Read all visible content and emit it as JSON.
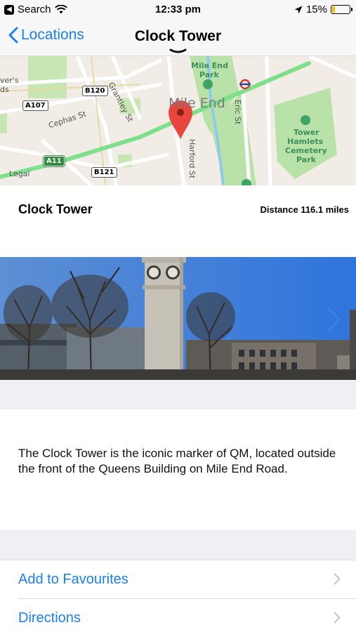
{
  "status_bar": {
    "back_app": "Search",
    "time": "12:33 pm",
    "battery": "15%",
    "battery_level": 0.15,
    "icons": [
      "wifi-icon",
      "location-arrow-icon",
      "battery-icon"
    ]
  },
  "nav": {
    "back_label": "Locations",
    "title": "Clock Tower"
  },
  "map": {
    "labels": {
      "mile_end_park": "Mile End Park",
      "mile_end_park_line1": "Mile End",
      "mile_end_park_line2": "Park",
      "area": "Mile End",
      "tower_hamlets_line1": "Tower",
      "tower_hamlets_line2": "Hamlets",
      "tower_hamlets_line3": "Cemetery",
      "tower_hamlets_line4": "Park",
      "grantley": "Grantley St",
      "cephas": "Cephas St",
      "eric": "Eric St",
      "harford": "Harford St",
      "partial_left_1": "ver's",
      "partial_left_2": "ds",
      "legal": "Legal"
    },
    "roads": {
      "b120": "B120",
      "a107": "A107",
      "a11": "A11",
      "b121": "B121"
    },
    "colors": {
      "pin": "#e8453c",
      "road_green": "#7ee08b",
      "park": "#b9e2a8"
    }
  },
  "place": {
    "name": "Clock Tower",
    "distance": "Distance 116.1 miles"
  },
  "description": "The Clock Tower is the iconic marker of QM, located outside the front of the Queens Building on Mile End Road.",
  "actions": {
    "favourites": "Add to Favourites",
    "directions": "Directions"
  },
  "colors": {
    "accent": "#1a7ff0",
    "group_background": "#efeff4"
  }
}
